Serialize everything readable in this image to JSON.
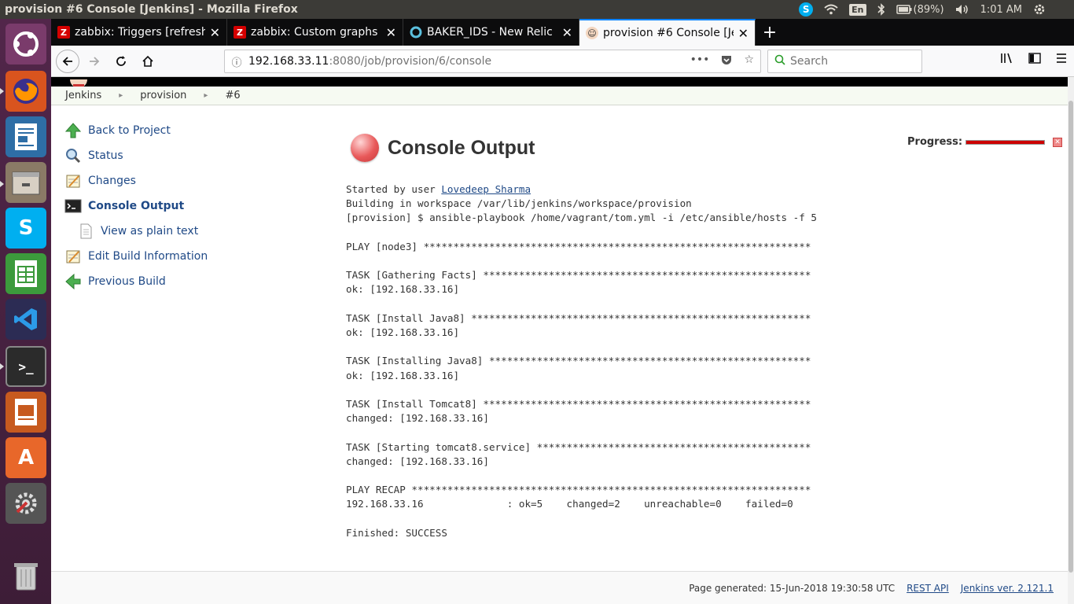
{
  "system": {
    "window_title": "provision #6 Console [Jenkins] - Mozilla Firefox",
    "lang": "En",
    "battery": "(89%)",
    "clock": "1:01 AM"
  },
  "browser": {
    "tabs": [
      {
        "label": "zabbix: Triggers [refresh",
        "favicon": "Z"
      },
      {
        "label": "zabbix: Custom graphs [",
        "favicon": "Z"
      },
      {
        "label": "BAKER_IDS - New Relic",
        "favicon": "O"
      },
      {
        "label": "provision #6 Console [Je",
        "favicon": "J"
      }
    ],
    "url_host": "192.168.33.11",
    "url_rest": ":8080/job/provision/6/console",
    "search_placeholder": "Search",
    "page_actions": "•••"
  },
  "jenkins": {
    "breadcrumb": [
      "Jenkins",
      "provision",
      "#6"
    ],
    "side_tasks": [
      {
        "label": "Back to Project"
      },
      {
        "label": "Status"
      },
      {
        "label": "Changes"
      },
      {
        "label": "Console Output"
      },
      {
        "label": "View as plain text"
      },
      {
        "label": "Edit Build Information"
      },
      {
        "label": "Previous Build"
      }
    ],
    "title": "Console Output",
    "progress_label": "Progress:",
    "console": {
      "started_prefix": "Started by user ",
      "user": "Lovedeep Sharma",
      "lines": "Building in workspace /var/lib/jenkins/workspace/provision\n[provision] $ ansible-playbook /home/vagrant/tom.yml -i /etc/ansible/hosts -f 5\n\nPLAY [node3] *****************************************************************\n\nTASK [Gathering Facts] *******************************************************\nok: [192.168.33.16]\n\nTASK [Install Java8] *********************************************************\nok: [192.168.33.16]\n\nTASK [Installing Java8] ******************************************************\nok: [192.168.33.16]\n\nTASK [Install Tomcat8] *******************************************************\nchanged: [192.168.33.16]\n\nTASK [Starting tomcat8.service] **********************************************\nchanged: [192.168.33.16]\n\nPLAY RECAP *******************************************************************\n192.168.33.16              : ok=5    changed=2    unreachable=0    failed=0\n\nFinished: SUCCESS"
    },
    "footer": {
      "generated": "Page generated: 15-Jun-2018 19:30:58 UTC",
      "rest_api": "REST API",
      "version": "Jenkins ver. 2.121.1"
    }
  }
}
